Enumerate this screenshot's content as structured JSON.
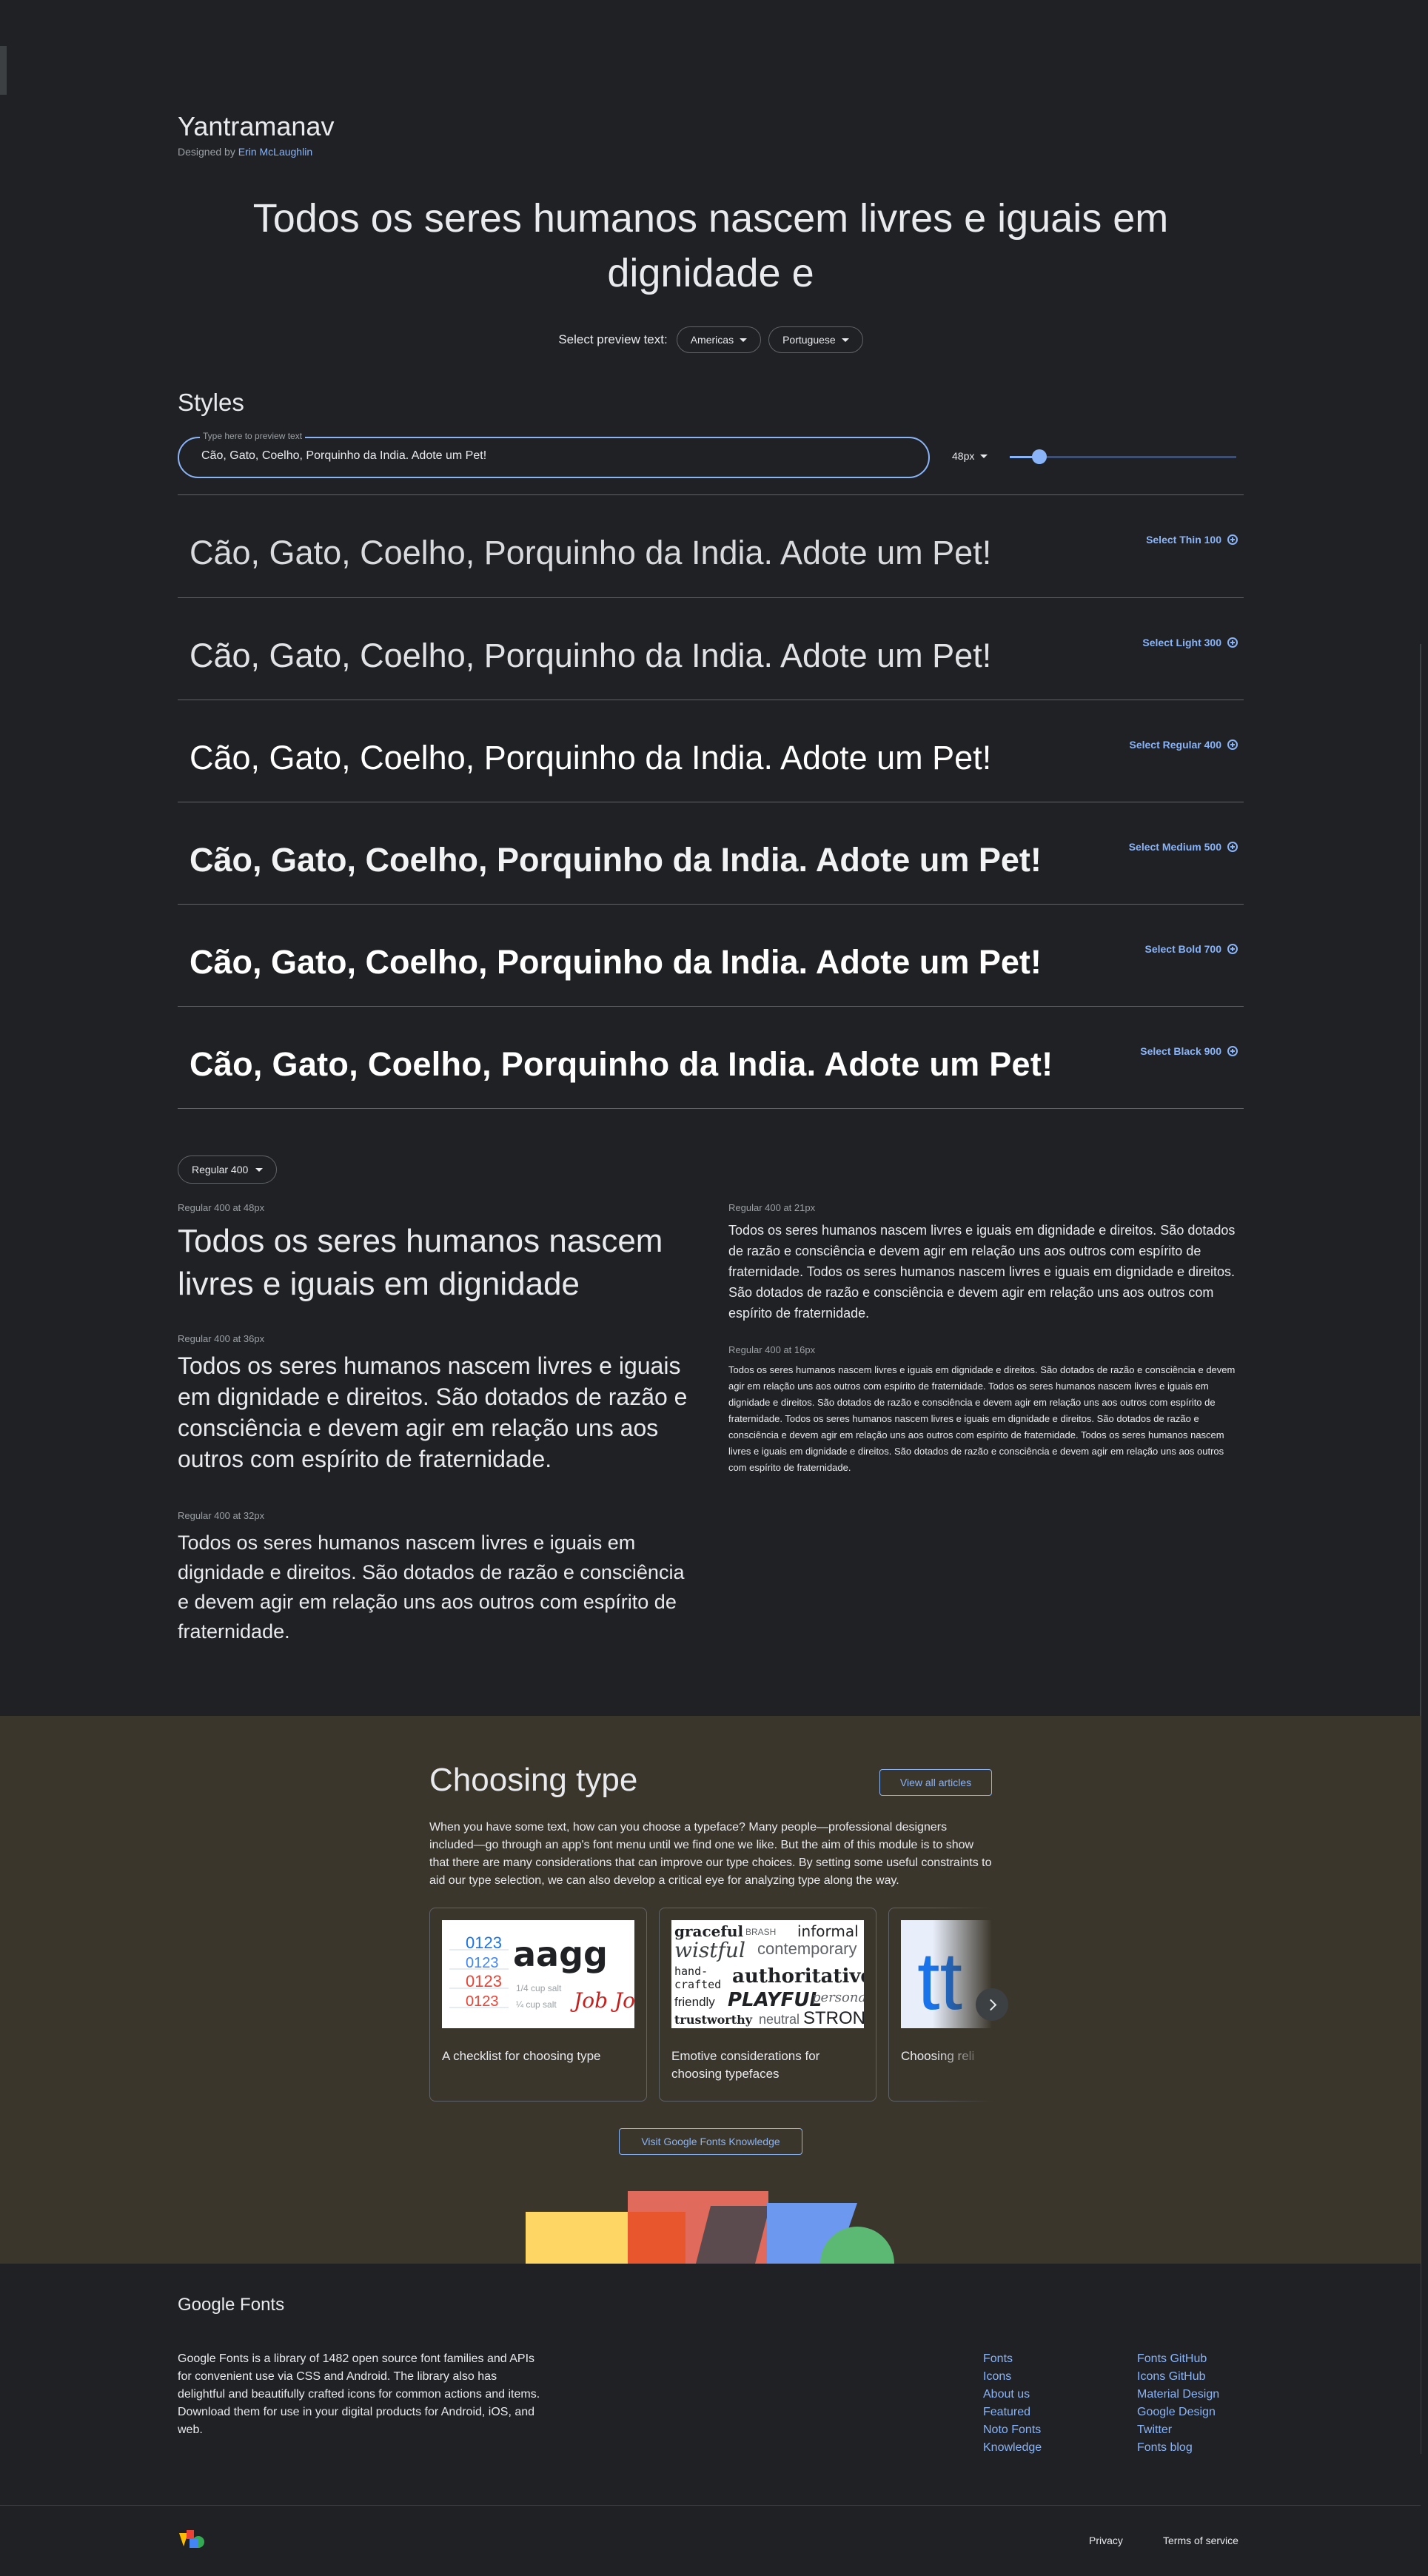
{
  "family": {
    "name": "Yantramanav",
    "designer_prefix": "Designed by",
    "designer": "Erin McLaughlin"
  },
  "hero_text": "Todos os seres humanos nascem livres e iguais em dignidade e",
  "preview": {
    "label": "Select preview text:",
    "region": "Americas",
    "language": "Portuguese"
  },
  "styles": {
    "title": "Styles",
    "field_label": "Type here to preview text",
    "field_value": "Cão, Gato, Coelho, Porquinho da India. Adote um Pet!",
    "size": "48px",
    "size_slider_fraction": 0.1,
    "rows": [
      {
        "sample": "Cão, Gato, Coelho, Porquinho da India. Adote um Pet!",
        "action": "Select Thin 100",
        "weight": 100
      },
      {
        "sample": "Cão, Gato, Coelho, Porquinho da India. Adote um Pet!",
        "action": "Select Light 300",
        "weight": 300
      },
      {
        "sample": "Cão, Gato, Coelho, Porquinho da India. Adote um Pet!",
        "action": "Select Regular 400",
        "weight": 400
      },
      {
        "sample": "Cão, Gato, Coelho, Porquinho da India. Adote um Pet!",
        "action": "Select Medium 500",
        "weight": 500
      },
      {
        "sample": "Cão, Gato, Coelho, Porquinho da India. Adote um Pet!",
        "action": "Select Bold 700",
        "weight": 700
      },
      {
        "sample": "Cão, Gato, Coelho, Porquinho da India. Adote um Pet!",
        "action": "Select Black 900",
        "weight": 900
      }
    ]
  },
  "type_tester": {
    "weight_select": "Regular 400",
    "samples": [
      {
        "label": "Regular 400 at 48px",
        "text": "Todos os seres humanos nascem livres e iguais em dignidade"
      },
      {
        "label": "Regular 400 at 36px",
        "text": "Todos os seres humanos nascem livres e iguais em dignidade e direitos. São dotados de razão e consciência e devem agir em relação uns aos outros com espírito de fraternidade."
      },
      {
        "label": "Regular 400 at 32px",
        "text": "Todos os seres humanos nascem livres e iguais em dignidade e direitos. São dotados de razão e consciência e devem agir em relação uns aos outros com espírito de fraternidade."
      },
      {
        "label": "Regular 400 at 21px",
        "text": "Todos os seres humanos nascem livres e iguais em dignidade e direitos. São dotados de razão e consciência e devem agir em relação uns aos outros com espírito de fraternidade. Todos os seres humanos nascem livres e iguais em dignidade e direitos. São dotados de razão e consciência e devem agir em relação uns aos outros com espírito de fraternidade."
      },
      {
        "label": "Regular 400 at 16px",
        "text": "Todos os seres humanos nascem livres e iguais em dignidade e direitos. São dotados de razão e consciência e devem agir em relação uns aos outros com espírito de fraternidade. Todos os seres humanos nascem livres e iguais em dignidade e direitos. São dotados de razão e consciência e devem agir em relação uns aos outros com espírito de fraternidade. Todos os seres humanos nascem livres e iguais em dignidade e direitos. São dotados de razão e consciência e devem agir em relação uns aos outros com espírito de fraternidade. Todos os seres humanos nascem livres e iguais em dignidade e direitos. São dotados de razão e consciência e devem agir em relação uns aos outros com espírito de fraternidade."
      }
    ]
  },
  "choosing_type": {
    "title": "Choosing type",
    "view_all": "View all articles",
    "description": "When you have some text, how can you choose a typeface? Many people—professional designers included—go through an app's font menu until we find one we like. But the aim of this module is to show that there are many considerations that can improve our type choices. By setting some useful constraints to aid our type selection, we can also develop a critical eye for analyzing type along the way.",
    "cards": [
      {
        "title": "A checklist for choosing type",
        "image_text": {
          "digits": "0123",
          "big": "aagg",
          "small1": "1/4 cup salt",
          "small2": "¼ cup salt",
          "script": "Job Job"
        }
      },
      {
        "title": "Emotive considerations for choosing typefaces",
        "image_text": {
          "w1": "graceful",
          "w2": "BRASH",
          "w3": "informal",
          "w4": "wistful",
          "w5": "contemporary",
          "w6": "hand-",
          "w7": "crafted",
          "w8": "authoritative",
          "w9": "friendly",
          "w10": "PLAYFUL",
          "w11": "personal",
          "w12": "trustworthy",
          "w13": "neutral",
          "w14": "STRONG"
        }
      },
      {
        "title": "Choosing reliable typefaces",
        "image_text": {
          "letters": "tt"
        }
      }
    ],
    "knowledge_button": "Visit Google Fonts Knowledge"
  },
  "footer": {
    "logo": "Google Fonts",
    "description": "Google Fonts is a library of 1482 open source font families and APIs for convenient use via CSS and Android. The library also has delightful and beautifully crafted icons for common actions and items. Download them for use in your digital products for Android, iOS, and web.",
    "col1": [
      "Fonts",
      "Icons",
      "About us",
      "Featured",
      "Noto Fonts",
      "Knowledge"
    ],
    "col2": [
      "Fonts GitHub",
      "Icons GitHub",
      "Material Design",
      "Google Design",
      "Twitter",
      "Fonts blog"
    ],
    "privacy": "Privacy",
    "terms": "Terms of service"
  },
  "colors": {
    "background": "#202124",
    "accent": "#8ab4f8",
    "band": "#3b362b",
    "divider": "#5f6368"
  },
  "icons": {
    "dropdown": "caret-down-icon",
    "add": "plus-circle-icon",
    "next": "chevron-right-icon",
    "brand": "google-fonts-logo-icon"
  }
}
